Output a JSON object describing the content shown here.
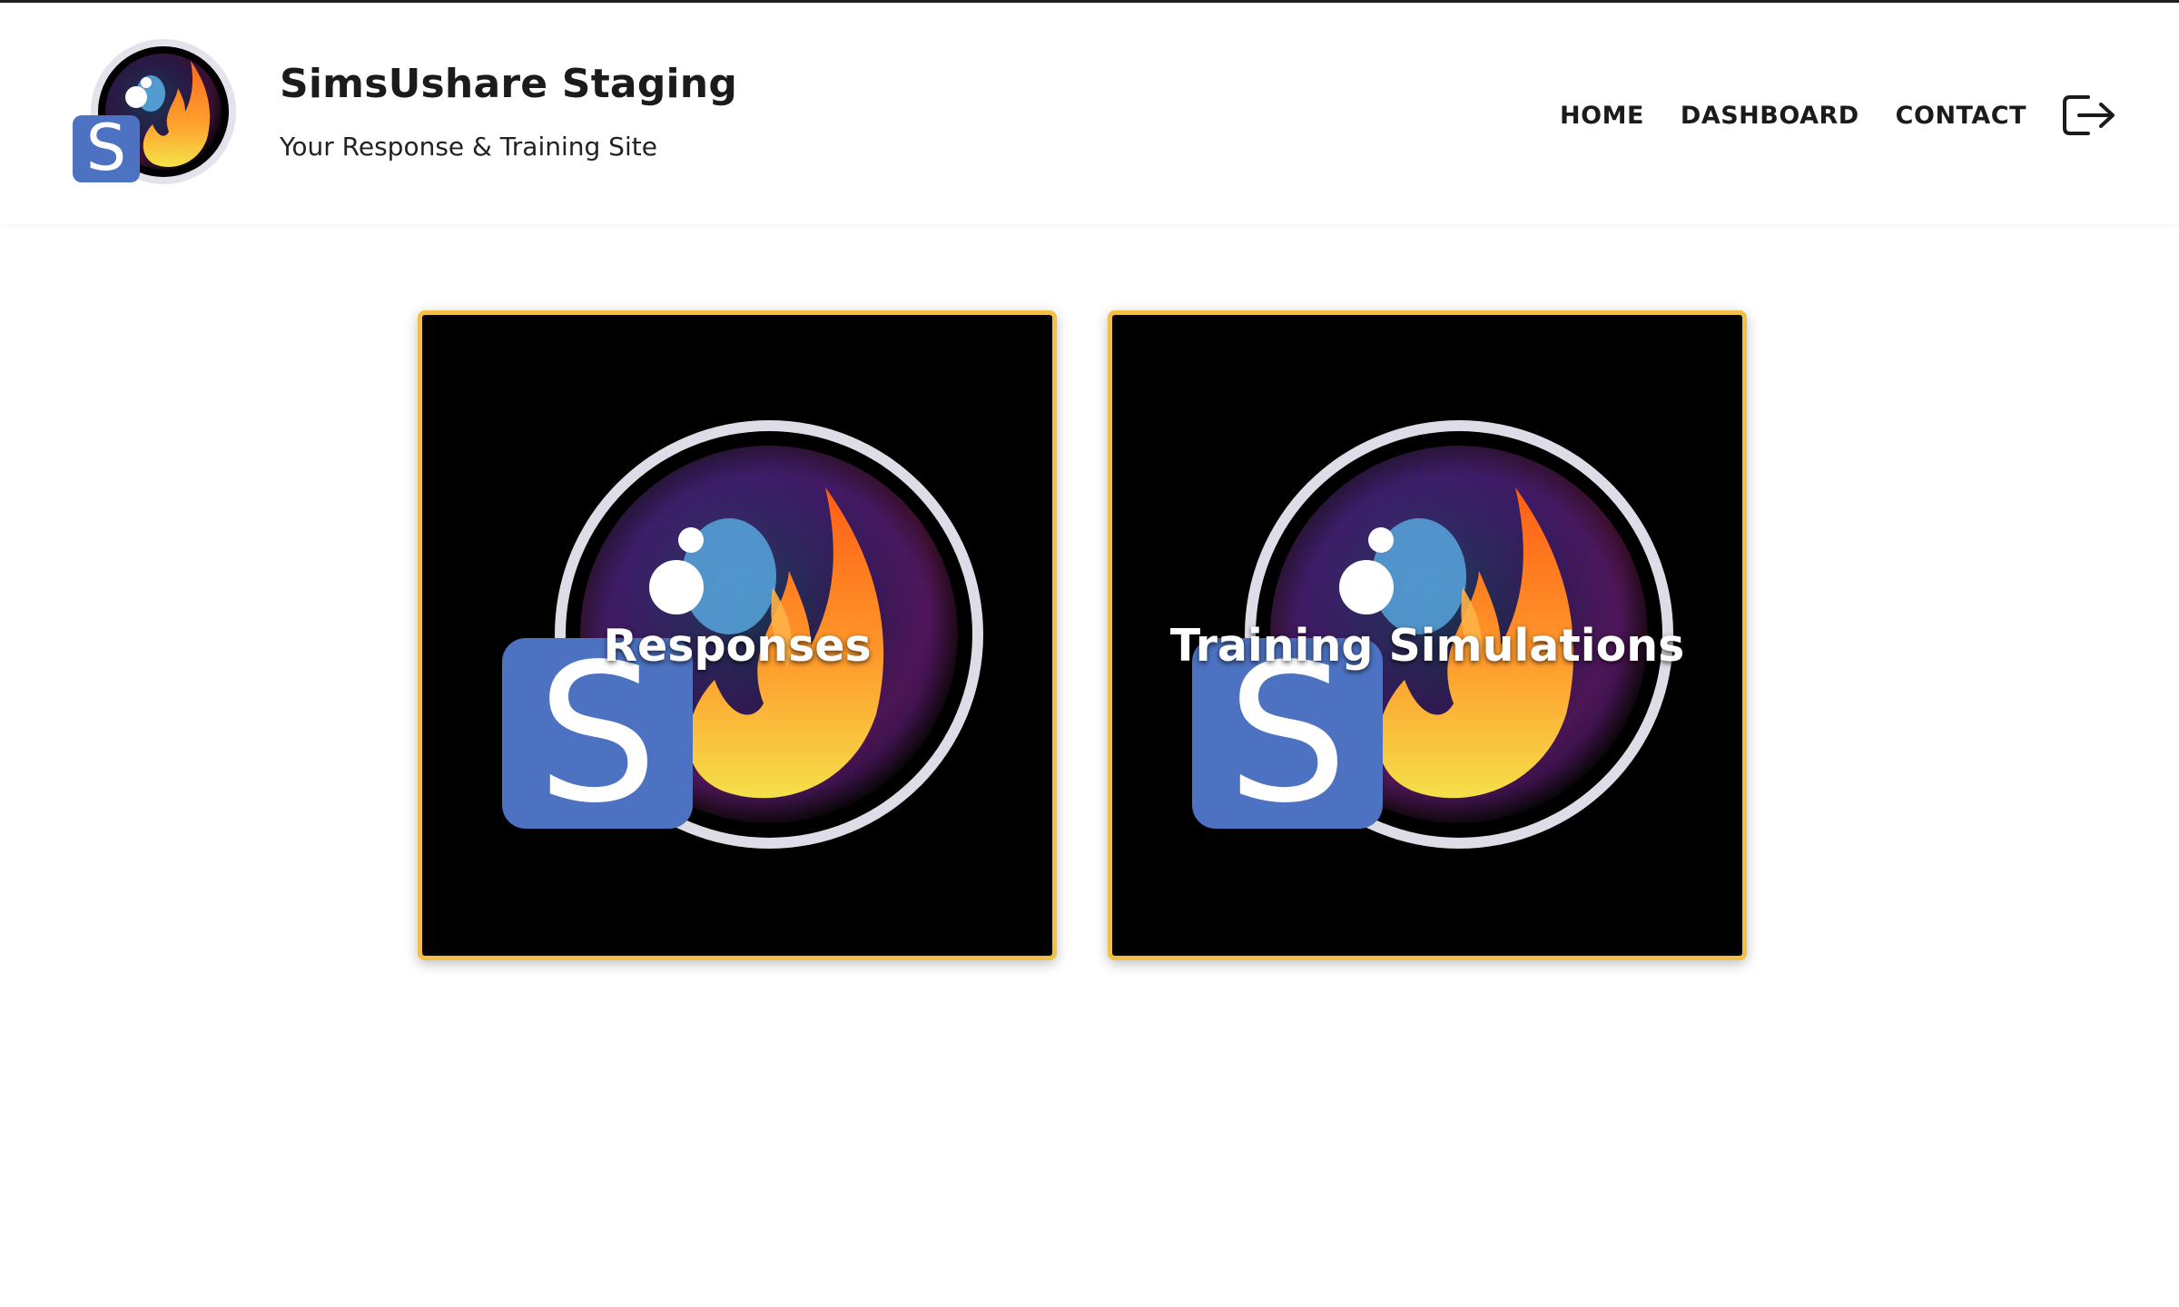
{
  "site": {
    "title": "SimsUshare Staging",
    "tagline": "Your Response & Training Site",
    "logo_icon": "simsushare-logo-icon"
  },
  "nav": {
    "items": [
      {
        "label": "HOME"
      },
      {
        "label": "DASHBOARD"
      },
      {
        "label": "CONTACT"
      }
    ],
    "logout_icon": "logout-icon"
  },
  "cards": [
    {
      "label": "Responses",
      "icon": "simsushare-logo-icon"
    },
    {
      "label": "Training Simulations",
      "icon": "simsushare-logo-icon"
    }
  ],
  "colors": {
    "card_border": "#f2c043",
    "card_background": "#000000",
    "logo_badge_blue": "#4c72c1",
    "text_dark": "#1b1b1b"
  }
}
